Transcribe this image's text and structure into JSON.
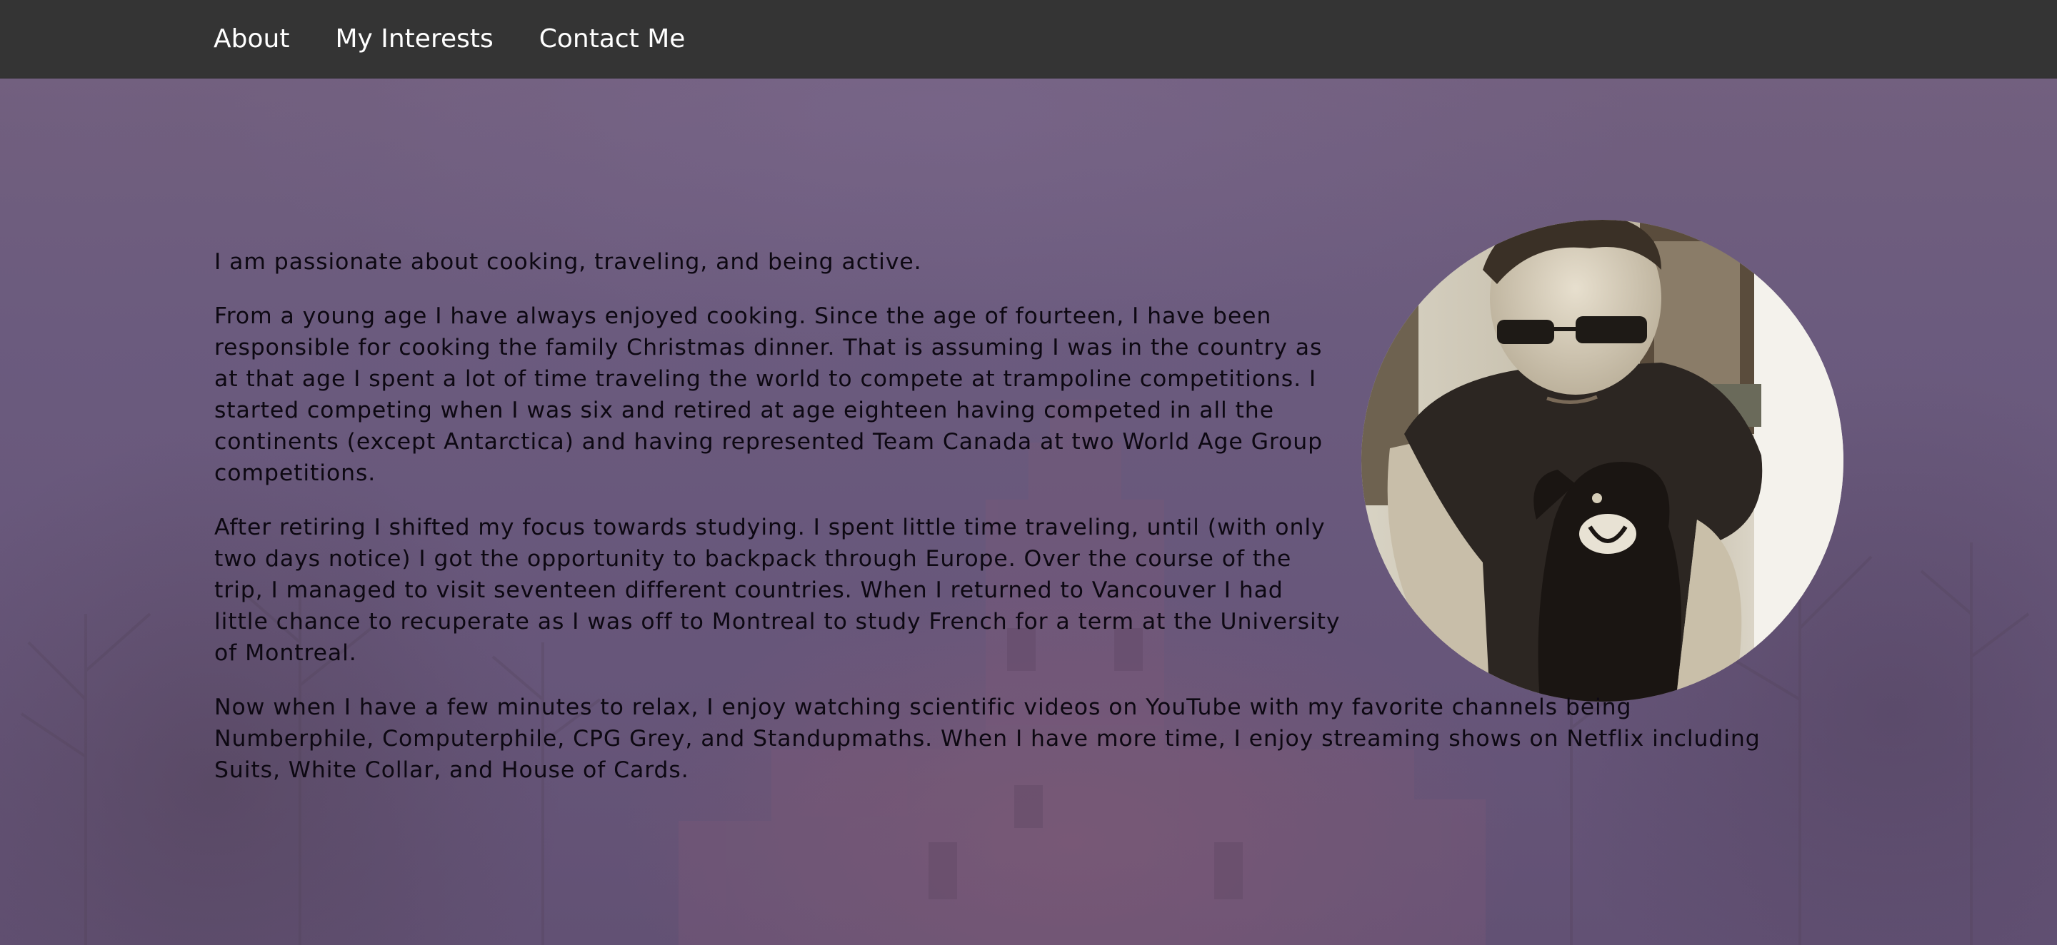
{
  "nav": {
    "items": [
      {
        "label": "About"
      },
      {
        "label": "My Interests"
      },
      {
        "label": "Contact Me"
      }
    ]
  },
  "main": {
    "paragraphs": [
      "I am passionate about cooking, traveling, and being active.",
      "From a young age I have always enjoyed cooking. Since the age of fourteen, I have been responsible for cooking the family Christmas dinner. That is assuming I was in the country as at that age I spent a lot of time traveling the world to compete at trampoline competitions. I started competing when I was six and retired at age eighteen having competed in all the continents (except Antarctica) and having represented Team Canada at two World Age Group competitions.",
      "After retiring I shifted my focus towards studying. I spent little time traveling, until (with only two days notice) I got the opportunity to backpack through Europe. Over the course of the trip, I managed to visit seventeen different countries. When I returned to Vancouver I had little chance to recuperate as I was off to Montreal to study French for a term at the University of Montreal.",
      "Now when I have a few minutes to relax, I enjoy watching scientific videos on YouTube with my favorite channels being Numberphile, Computerphile, CPG Grey, and Standupmaths. When I have more time, I enjoy streaming shows on Netflix including Suits, White Collar, and House of Cards."
    ]
  },
  "colors": {
    "navbar": "#343434",
    "nav_text": "#ffffff",
    "background_overlay": "#6b5b7e",
    "body_text": "#0d0812"
  }
}
